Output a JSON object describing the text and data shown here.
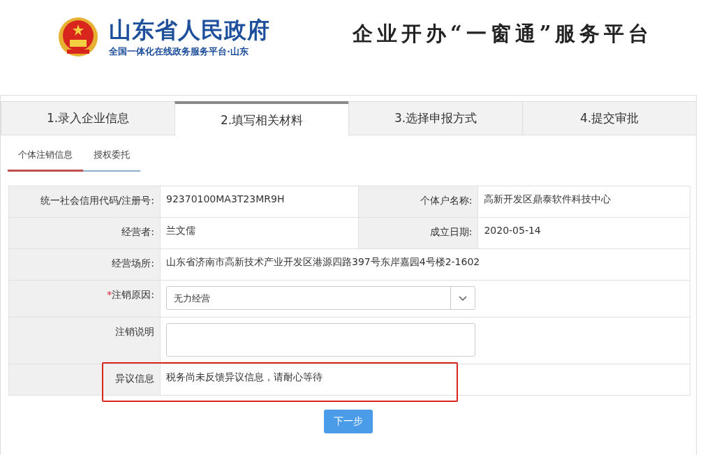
{
  "header": {
    "title": "山东省人民政府",
    "subtitle": "全国一体化在线政务服务平台·山东",
    "platform_title": "企业开办“一窗通”服务平台"
  },
  "steps": [
    {
      "label": "1.录入企业信息",
      "selected": false
    },
    {
      "label": "2.填写相关材料",
      "selected": true
    },
    {
      "label": "3.选择申报方式",
      "selected": false
    },
    {
      "label": "4.提交审批",
      "selected": false
    }
  ],
  "subtabs": [
    {
      "label": "个体注销信息",
      "selected": true
    },
    {
      "label": "授权委托",
      "selected": false
    }
  ],
  "form_rows": [
    {
      "kind": "pair",
      "label": "统一社会信用代码/注册号:",
      "value": "92370100MA3T23MR9H",
      "label_2": "个体户名称:",
      "value_2": "高新开发区鼎泰软件科技中心"
    },
    {
      "kind": "pair",
      "label": "经营者:",
      "value": "兰文儒",
      "label_2": "成立日期:",
      "value_2": "2020-05-14"
    },
    {
      "kind": "text",
      "label": "经营场所:",
      "value": "山东省济南市高新技术产业开发区港源四路397号东岸嘉园4号楼2-1602"
    },
    {
      "kind": "select",
      "required_mark": "*",
      "label": "注销原因:",
      "value": "无力经营"
    },
    {
      "kind": "textarea",
      "label": "注销说明"
    },
    {
      "kind": "text",
      "label": "异议信息",
      "value": "税务尚未反馈异议信息，请耐心等待"
    }
  ],
  "next_button": "下一步"
}
